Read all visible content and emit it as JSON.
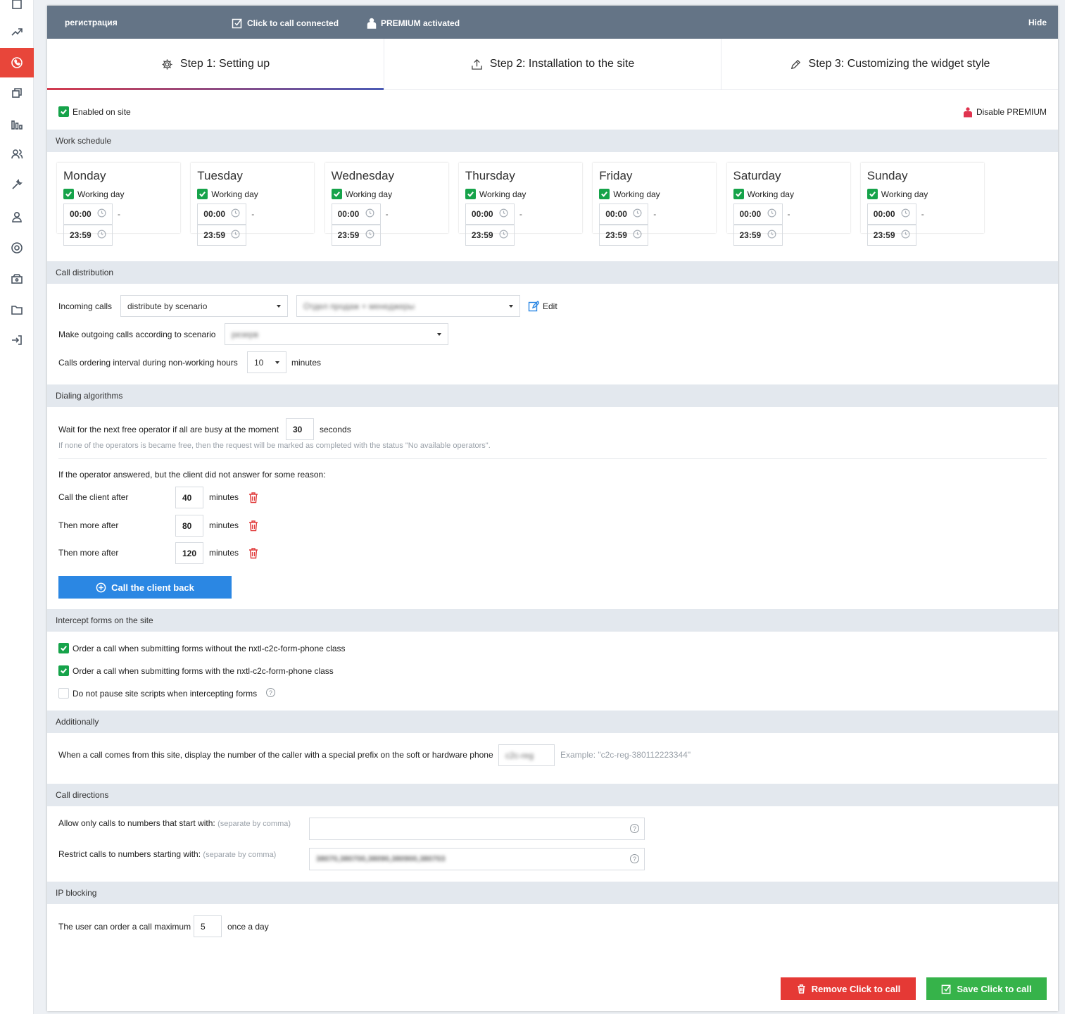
{
  "colors": {
    "accent_red": "#e8463a",
    "topbar": "#647486",
    "check_green": "#16a34a",
    "primary_blue": "#2b87e3",
    "danger_red": "#e53935",
    "success_green": "#36b34a"
  },
  "sidebar": {
    "icons": [
      "square-icon",
      "trend-icon",
      "phone-icon",
      "layers-icon",
      "bar-chart-icon",
      "users-icon",
      "wrench-icon",
      "user-icon",
      "support-icon",
      "cashbox-icon",
      "folder-icon",
      "logout-icon"
    ],
    "active": "phone-icon"
  },
  "topbar": {
    "widget_name": "регистрация",
    "status_connected": "Click to call connected",
    "status_premium": "PREMIUM activated",
    "hide_label": "Hide"
  },
  "steps": [
    {
      "label": "Step 1: Setting up",
      "icon": "gear-icon"
    },
    {
      "label": "Step 2: Installation to the site",
      "icon": "upload-icon"
    },
    {
      "label": "Step 3: Customizing the widget style",
      "icon": "pencil-icon"
    }
  ],
  "enabled_label": "Enabled on site",
  "disable_premium_label": "Disable PREMIUM",
  "sections": {
    "work_schedule": "Work schedule",
    "call_distribution": "Call distribution",
    "dialing": "Dialing algorithms",
    "intercept": "Intercept forms on the site",
    "additionally": "Additionally",
    "directions": "Call directions",
    "ip": "IP blocking"
  },
  "days": [
    {
      "name": "Monday",
      "working_label": "Working day",
      "from": "00:00",
      "to": "23:59"
    },
    {
      "name": "Tuesday",
      "working_label": "Working day",
      "from": "00:00",
      "to": "23:59"
    },
    {
      "name": "Wednesday",
      "working_label": "Working day",
      "from": "00:00",
      "to": "23:59"
    },
    {
      "name": "Thursday",
      "working_label": "Working day",
      "from": "00:00",
      "to": "23:59"
    },
    {
      "name": "Friday",
      "working_label": "Working day",
      "from": "00:00",
      "to": "23:59"
    },
    {
      "name": "Saturday",
      "working_label": "Working day",
      "from": "00:00",
      "to": "23:59"
    },
    {
      "name": "Sunday",
      "working_label": "Working day",
      "from": "00:00",
      "to": "23:59"
    }
  ],
  "time_sep": "-",
  "distribution": {
    "incoming_label": "Incoming calls",
    "incoming_mode": "distribute by scenario",
    "incoming_scenario": "Отдел продаж + менеджеры",
    "edit_label": "Edit",
    "outgoing_label": "Make outgoing calls according to scenario",
    "outgoing_scenario": "резерв",
    "interval_label": "Calls ordering interval during non-working hours",
    "interval_value": "10",
    "interval_unit": "minutes"
  },
  "dialing": {
    "wait_label": "Wait for the next free operator if all are busy at the moment",
    "wait_value": "30",
    "wait_unit": "seconds",
    "wait_hint": "If none of the operators is became free, then the request will be marked as completed with the status \"No available operators\".",
    "noanswer_label": "If the operator answered, but the client did not answer for some reason:",
    "retries": [
      {
        "label": "Call the client after",
        "value": "40",
        "unit": "minutes"
      },
      {
        "label": "Then more after",
        "value": "80",
        "unit": "minutes"
      },
      {
        "label": "Then more after",
        "value": "120",
        "unit": "minutes"
      }
    ],
    "callback_button": "Call the client back"
  },
  "intercept": {
    "opt1": "Order a call when submitting forms without the nxtl-c2c-form-phone class",
    "opt2": "Order a call when submitting forms with the nxtl-c2c-form-phone class",
    "opt3": "Do not pause site scripts when intercepting forms",
    "help_mark": "?"
  },
  "additionally": {
    "prefix_label": "When a call comes from this site, display the number of the caller with a special prefix on the soft or hardware phone",
    "prefix_value": "c2c-reg",
    "example": "Example: \"c2c-reg-380112223344\""
  },
  "directions": {
    "allow_label": "Allow only calls to numbers that start with:",
    "allow_hint": "(separate by comma)",
    "allow_value": "",
    "restrict_label": "Restrict calls to numbers starting with:",
    "restrict_hint": "(separate by comma)",
    "restrict_value": "38070,380700,38090,380900,380703",
    "help_mark": "?"
  },
  "ip": {
    "label": "The user can order a call maximum",
    "value": "5",
    "unit": "once a day"
  },
  "actions": {
    "remove": "Remove Click to call",
    "save": "Save Click to call"
  }
}
